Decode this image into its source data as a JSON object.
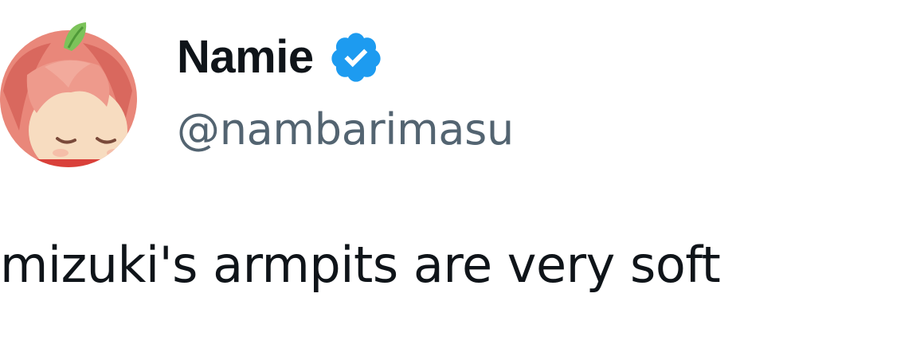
{
  "tweet": {
    "author": {
      "display_name": "Namie",
      "handle": "@nambarimasu",
      "verified": true,
      "avatar_icon": "anime-character-avatar"
    },
    "text": "mizuki's armpits are very soft"
  },
  "colors": {
    "name_text": "#0f1419",
    "handle_text": "#536471",
    "body_text": "#0f1419",
    "verified_badge": "#1d9bf0",
    "background": "#ffffff"
  }
}
